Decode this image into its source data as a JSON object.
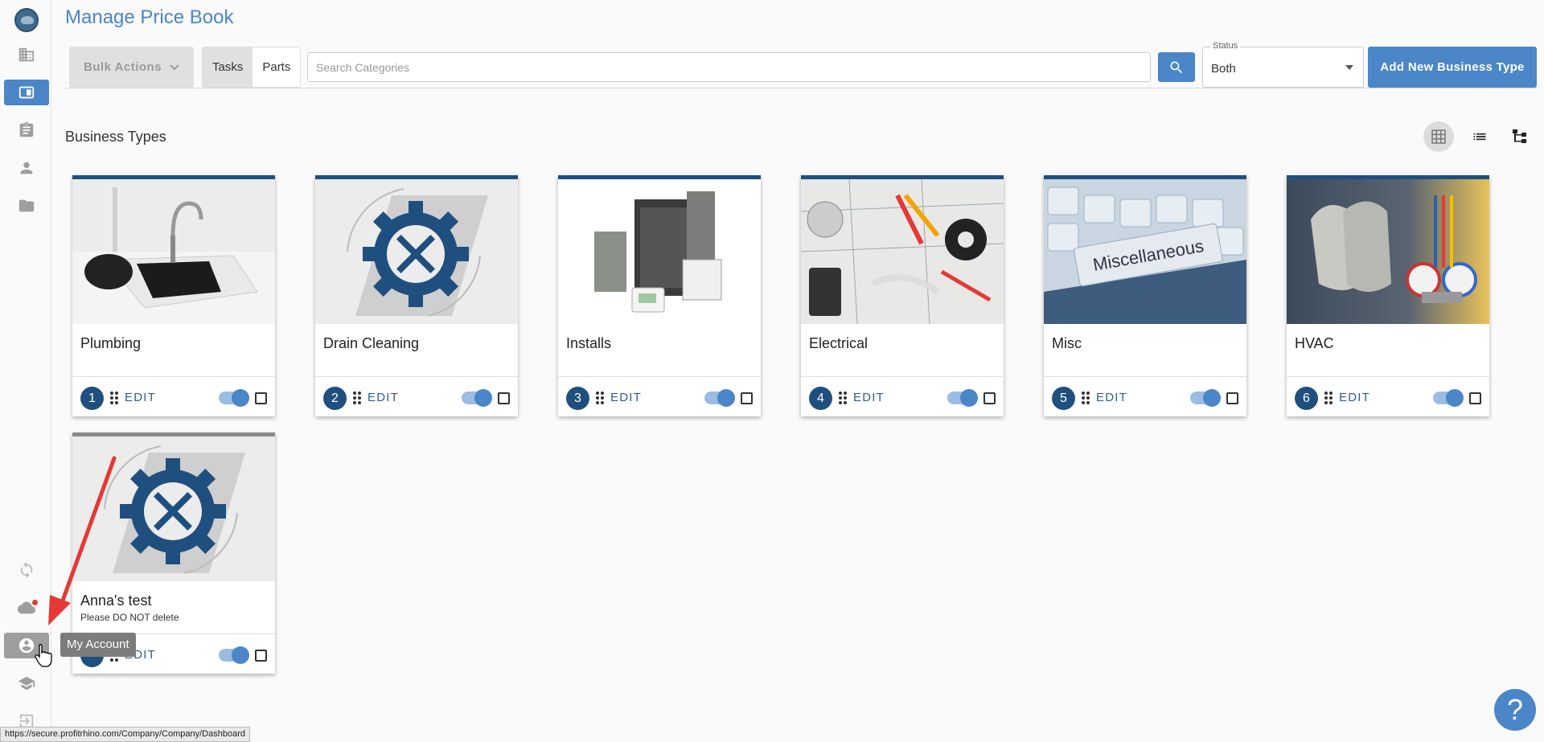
{
  "page": {
    "title": "Manage Price Book",
    "section_title": "Business Types"
  },
  "toolbar": {
    "bulk_actions_label": "Bulk Actions",
    "tab_tasks": "Tasks",
    "tab_parts": "Parts",
    "search_placeholder": "Search Categories",
    "status_label": "Status",
    "status_value": "Both",
    "add_button_label": "Add New Business Type"
  },
  "cards": [
    {
      "title": "Plumbing",
      "subtitle": "",
      "number": "1",
      "edit": "EDIT",
      "enabled": true
    },
    {
      "title": "Drain Cleaning",
      "subtitle": "",
      "number": "2",
      "edit": "EDIT",
      "enabled": true
    },
    {
      "title": "Installs",
      "subtitle": "",
      "number": "3",
      "edit": "EDIT",
      "enabled": true
    },
    {
      "title": "Electrical",
      "subtitle": "",
      "number": "4",
      "edit": "EDIT",
      "enabled": true
    },
    {
      "title": "Misc",
      "subtitle": "",
      "number": "5",
      "edit": "EDIT",
      "enabled": true,
      "image_text": "Miscellaneous"
    },
    {
      "title": "HVAC",
      "subtitle": "",
      "number": "6",
      "edit": "EDIT",
      "enabled": true
    },
    {
      "title": "Anna's test",
      "subtitle": "Please DO NOT delete",
      "number": "",
      "edit": "EDIT",
      "enabled": true
    }
  ],
  "tooltip": {
    "text": "My Account"
  },
  "status_bar": {
    "url": "https://secure.profitrhino.com/Company/Company/Dashboard"
  },
  "help": {
    "label": "?"
  },
  "colors": {
    "accent": "#4a86c8",
    "navy": "#1f4f7e",
    "annotation_arrow": "#e53935"
  },
  "sidebar_icons": [
    "company-logo",
    "building-icon",
    "price-book-icon",
    "clipboard-icon",
    "person-icon",
    "folder-icon",
    "sync-icon",
    "cloud-icon",
    "account-circle-icon",
    "graduation-cap-icon",
    "logout-icon"
  ]
}
